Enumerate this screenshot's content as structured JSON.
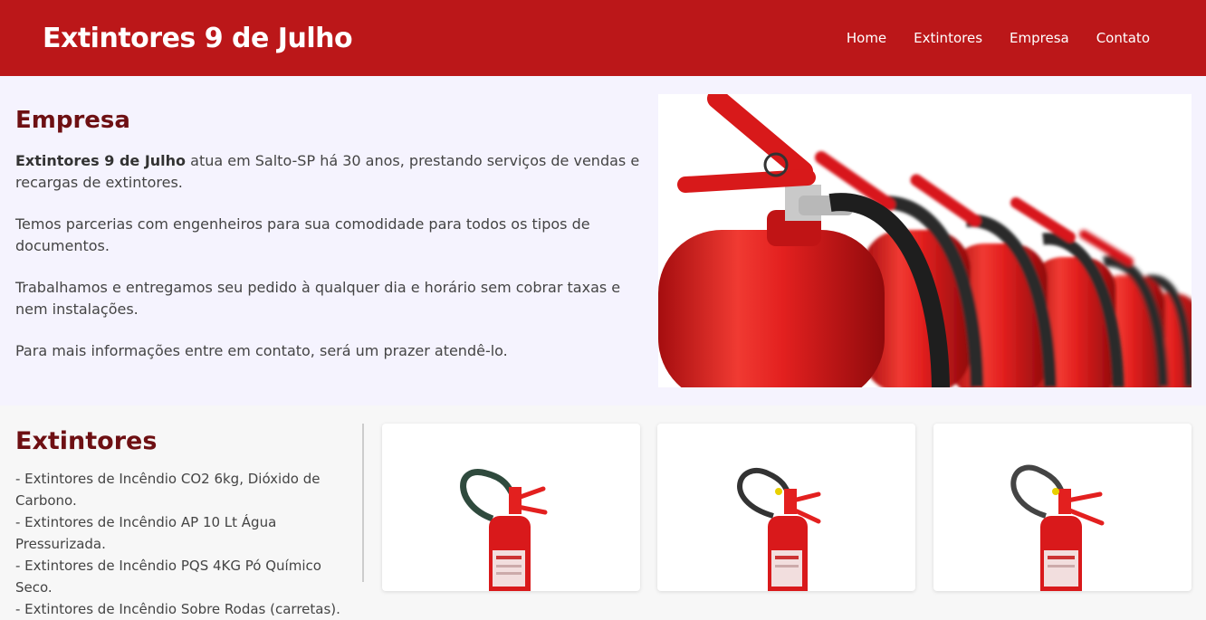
{
  "header": {
    "brand": "Extintores 9 de Julho",
    "nav": [
      "Home",
      "Extintores",
      "Empresa",
      "Contato"
    ]
  },
  "empresa": {
    "title": "Empresa",
    "p1_bold": "Extintores 9 de Julho",
    "p1_rest": " atua em Salto-SP há 30 anos, prestando serviços de vendas e recargas de extintores.",
    "p2": "Temos parcerias com engenheiros para sua comodidade para todos os tipos de documentos.",
    "p3": "Trabalhamos e entregamos seu pedido à qualquer dia e horário sem cobrar taxas e nem instalações.",
    "p4": "Para mais informações entre em contato, será um prazer atendê-lo."
  },
  "extintores": {
    "title": "Extintores",
    "items": [
      "- Extintores de Incêndio CO2 6kg, Dióxido de Carbono.",
      "- Extintores de Incêndio AP 10 Lt Água Pressurizada.",
      "- Extintores de Incêndio PQS 4KG Pó Químico Seco.",
      "- Extintores de Incêndio Sobre Rodas (carretas)."
    ]
  },
  "colors": {
    "header_bg": "#bb1719",
    "heading": "#6e1013",
    "extinguisher_red": "#e3201f"
  }
}
